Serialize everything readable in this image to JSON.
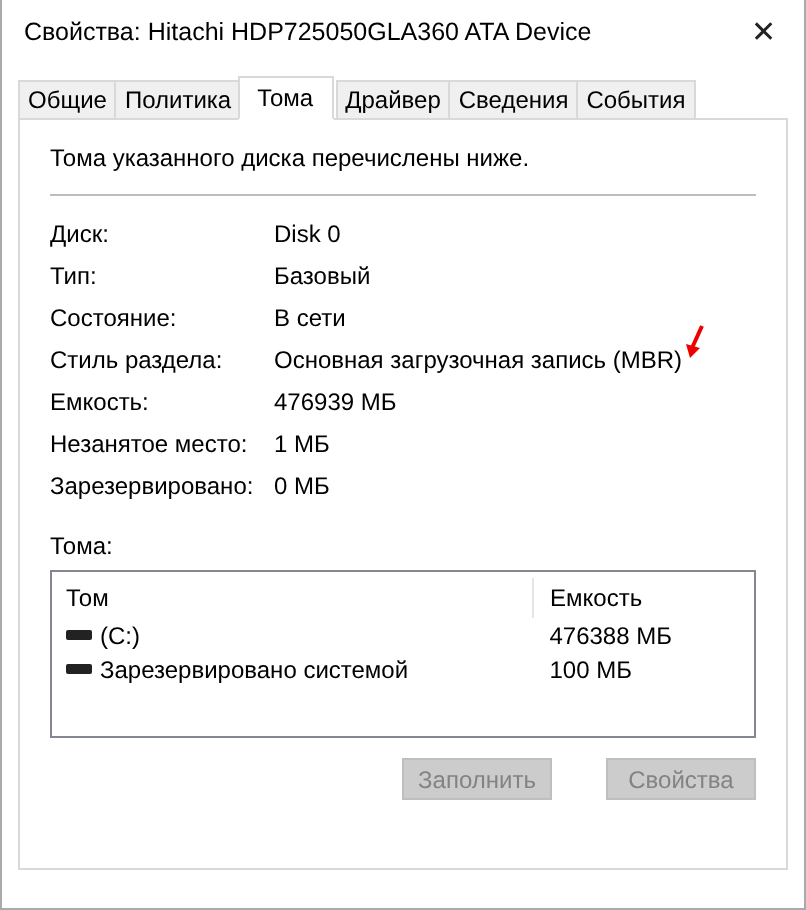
{
  "window": {
    "title": "Свойства: Hitachi HDP725050GLA360 ATA Device",
    "close": "✕"
  },
  "tabs": [
    {
      "label": "Общие",
      "selected": false
    },
    {
      "label": "Политика",
      "selected": false
    },
    {
      "label": "Тома",
      "selected": true
    },
    {
      "label": "Драйвер",
      "selected": false
    },
    {
      "label": "Сведения",
      "selected": false
    },
    {
      "label": "События",
      "selected": false
    }
  ],
  "description": "Тома указанного диска перечислены ниже.",
  "properties": [
    {
      "label": "Диск:",
      "value": "Disk 0"
    },
    {
      "label": "Тип:",
      "value": "Базовый"
    },
    {
      "label": "Состояние:",
      "value": "В сети"
    },
    {
      "label": "Стиль раздела:",
      "value": "Основная загрузочная запись (MBR)"
    },
    {
      "label": "Емкость:",
      "value": "476939 МБ"
    },
    {
      "label": "Незанятое место:",
      "value": "1 МБ"
    },
    {
      "label": "Зарезервировано:",
      "value": "0 МБ"
    }
  ],
  "volumes": {
    "label": "Тома:",
    "columns": [
      "Том",
      "Емкость"
    ],
    "rows": [
      {
        "name": "(C:)",
        "capacity": "476388 МБ"
      },
      {
        "name": "Зарезервировано системой",
        "capacity": "100 МБ"
      }
    ]
  },
  "buttons": [
    {
      "label": "Заполнить",
      "disabled": true
    },
    {
      "label": "Свойства",
      "disabled": true
    }
  ]
}
